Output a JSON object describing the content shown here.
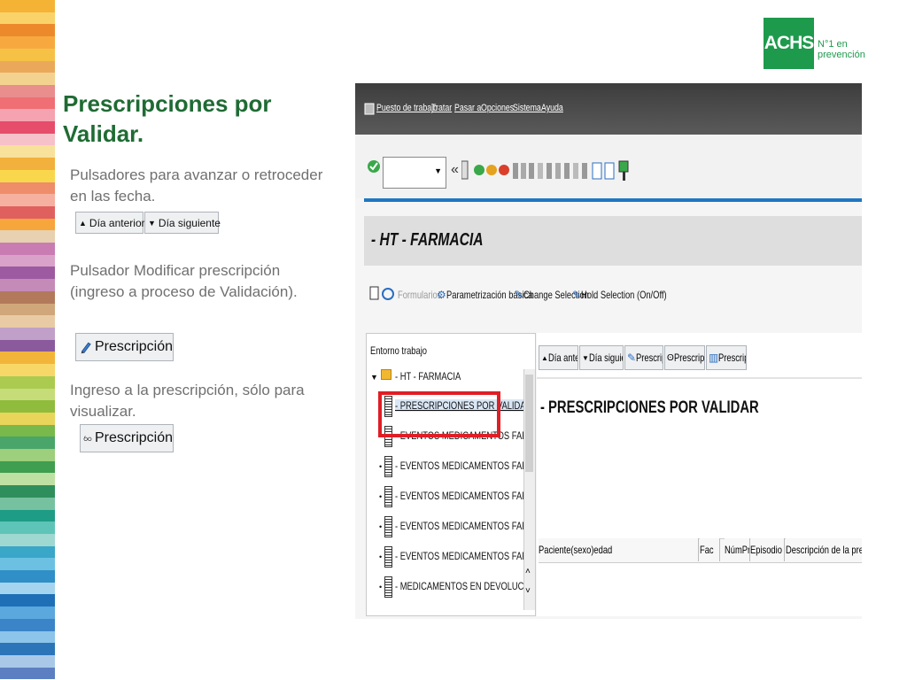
{
  "stripes": [
    "#f5b335",
    "#f9d36a",
    "#ec8a2b",
    "#f7a940",
    "#f6c246",
    "#eaa95a",
    "#f3d28f",
    "#e98d8d",
    "#ef6f74",
    "#f5a3b0",
    "#e64d6b",
    "#f7c1c9",
    "#f8e19a",
    "#f2b03c",
    "#f9d74c",
    "#ee8d6a",
    "#f6b0a0",
    "#e06060",
    "#f7a63b",
    "#e7d1b0",
    "#c97cb2",
    "#d9a3c9",
    "#9e5aa0",
    "#c58bb8",
    "#b27a5a",
    "#d0a77a",
    "#e8cba5",
    "#c0a0c8",
    "#8a5a9c",
    "#f2b53a",
    "#f7d768",
    "#aacb4f",
    "#c6dc79",
    "#8fbc3c",
    "#e8d55a",
    "#79b84a",
    "#4aa56a",
    "#9dcf7c",
    "#3f9e4f",
    "#bfe0a3",
    "#2f8f5c",
    "#76c2a0",
    "#1f9c86",
    "#5fc4b8",
    "#9fd8d0",
    "#3aa7c9",
    "#6cc1e3",
    "#2f8fc6",
    "#a5d5ee",
    "#1f6fb7",
    "#5aa8dd",
    "#3c84c8",
    "#8cc4ea",
    "#2b74b8",
    "#a9c8e8",
    "#5b7fc0"
  ],
  "logo": {
    "brand": "ACHS",
    "tagline_1": "N°1 en",
    "tagline_2": "prevención"
  },
  "title": "Prescripciones por Validar.",
  "blocks": [
    {
      "text": "Pulsadores para avanzar o retroceder en las fecha."
    },
    {
      "text": "Pulsador Modificar prescripción (ingreso a proceso de Validación)."
    },
    {
      "text": "Ingreso a la prescripción, sólo para visualizar."
    }
  ],
  "sample_buttons": {
    "dia_anterior": "Día anterior",
    "dia_siguiente": "Día siguiente",
    "prescripcion_edit": "Prescripción",
    "prescripcion_view": "Prescripción"
  },
  "sap": {
    "menu": [
      "Puesto de trabajo",
      "Tratar",
      "Pasar a",
      "Opciones",
      "Sistema",
      "Ayuda"
    ],
    "screen_title": "- HT - FARMACIA",
    "app_toolbar": [
      "Formularios",
      "Parametrización básica",
      "Change Selection",
      "Hold Selection (On/Off)"
    ],
    "tree_header": "Entorno trabajo",
    "tree_root": "- HT - FARMACIA",
    "tree_items": [
      "- PRESCRIPCIONES POR VALIDAR",
      "- EVENTOS MEDICAMENTOS FARMACIA CENTRAL",
      "- EVENTOS MEDICAMENTOS FARMACIA_HTURG",
      "- EVENTOS MEDICAMENTOS FARMACIA_AMB",
      "- EVENTOS MEDICAMENTOS FARMACIA_PABELL",
      "- EVENTOS MEDICAMENTOS FARMACIA_UPC",
      "- MEDICAMENTOS EN DEVOLUCION"
    ],
    "right_buttons": [
      "Día anterior",
      "Día siguiente",
      "Prescripción",
      "Prescripción",
      "Prescripción"
    ],
    "right_title": "- PRESCRIPCIONES POR VALIDAR",
    "columns": [
      "Paciente(sexo)edad",
      "Fac",
      "NúmPres",
      "Episodio",
      "Descripción de la prescripción"
    ]
  }
}
